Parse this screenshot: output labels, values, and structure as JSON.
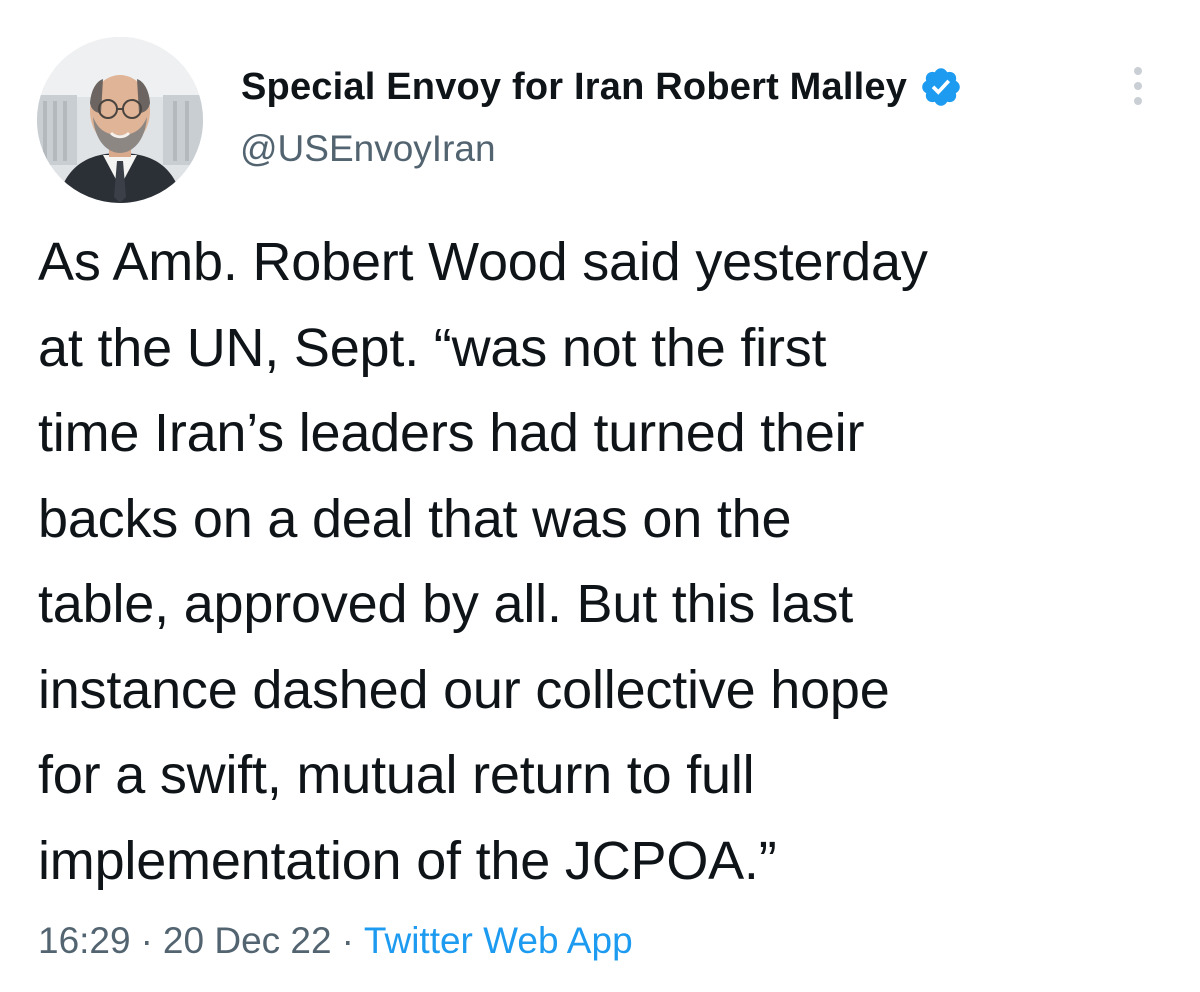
{
  "author": {
    "display_name": "Special Envoy for Iran Robert Malley",
    "handle": "@USEnvoyIran",
    "verified": true,
    "avatar": "profile-photo"
  },
  "tweet": {
    "text": "As Amb. Robert Wood said yesterday\nat the UN, Sept. “was not the first\ntime Iran’s leaders had turned their\nbacks on a deal that was on the\ntable, approved by all.  But this last\ninstance dashed our collective hope\nfor a swift, mutual return to full\nimplementation of the JCPOA.”"
  },
  "meta": {
    "time": "16:29",
    "separator": "·",
    "date": "20 Dec 22",
    "source": "Twitter Web App"
  },
  "icons": {
    "verified": "verified-badge-icon",
    "more": "more-options-icon"
  },
  "colors": {
    "accent": "#1d9bf0",
    "secondary_text": "#536471",
    "primary_text": "#0f1419"
  }
}
